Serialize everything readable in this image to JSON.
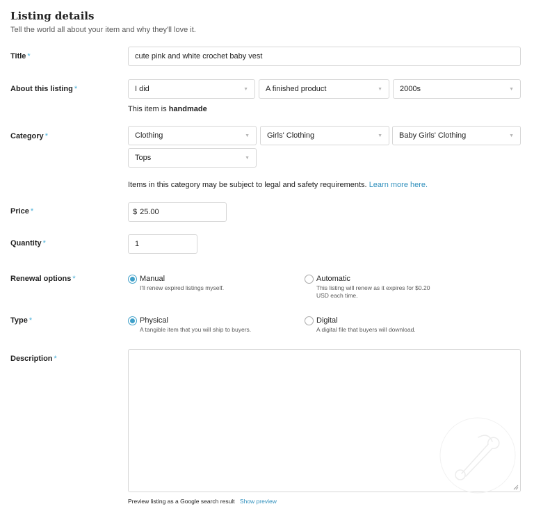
{
  "header": {
    "title": "Listing details",
    "subtitle": "Tell the world all about your item and why they'll love it."
  },
  "required_mark": "*",
  "title_field": {
    "label": "Title",
    "value": "cute pink and white crochet baby vest"
  },
  "about": {
    "label": "About this listing",
    "who_made": "I did",
    "what_is_it": "A finished product",
    "when_made": "2000s",
    "note_prefix": "This item is",
    "note_bold": "handmade"
  },
  "category": {
    "label": "Category",
    "level1": "Clothing",
    "level2": "Girls' Clothing",
    "level3": "Baby Girls' Clothing",
    "level4": "Tops",
    "note_text": "Items in this category may be subject to legal and safety requirements.",
    "note_link": "Learn more here."
  },
  "price": {
    "label": "Price",
    "currency": "$",
    "value": "25.00"
  },
  "quantity": {
    "label": "Quantity",
    "value": "1"
  },
  "renewal": {
    "label": "Renewal options",
    "options": [
      {
        "title": "Manual",
        "desc": "I'll renew expired listings myself.",
        "selected": true
      },
      {
        "title": "Automatic",
        "desc_line1": "This listing will renew as it expires for $0.20",
        "desc_line2": "USD each time.",
        "selected": false
      }
    ]
  },
  "type": {
    "label": "Type",
    "options": [
      {
        "title": "Physical",
        "desc": "A tangible item that you will ship to buyers.",
        "selected": true
      },
      {
        "title": "Digital",
        "desc": "A digital file that buyers will download.",
        "selected": false
      }
    ]
  },
  "description": {
    "label": "Description",
    "value": ""
  },
  "preview": {
    "text": "Preview listing as a Google search result",
    "link": "Show preview"
  },
  "colors": {
    "accent": "#3fa0c9",
    "required": "#4ab0d8",
    "link": "#2f8fbc",
    "border": "#d6d6d6"
  },
  "icons": {
    "dropdown": "chevron-down-icon",
    "radio_selected": "radio-checked-icon",
    "radio_unselected": "radio-unchecked-icon",
    "resize": "resize-grip-icon",
    "watermark": "safety-pin-icon"
  }
}
